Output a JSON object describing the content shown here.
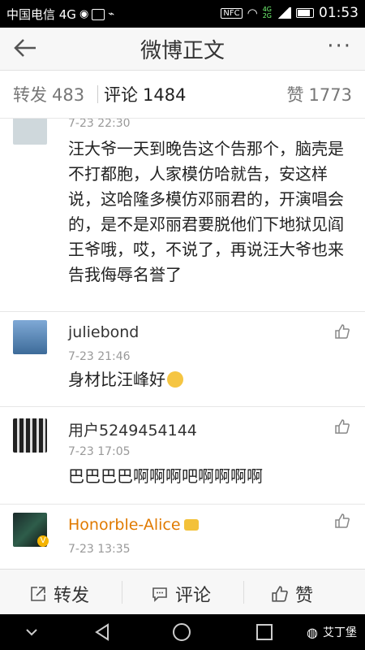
{
  "status_bar": {
    "carrier": "中国电信 4G",
    "nfc": "NFC",
    "net_top": "4G",
    "net_bottom": "2G",
    "time": "01:53"
  },
  "title_bar": {
    "back_icon": "back-arrow-icon",
    "title": "微博正文",
    "more_icon": "more-dots-icon",
    "more_glyph": "···"
  },
  "tabs": {
    "repost_label": "转发",
    "repost_count": "483",
    "comment_label": "评论",
    "comment_count": "1484",
    "like_label": "赞",
    "like_count": "1773"
  },
  "comments": [
    {
      "time": "7-23 22:30",
      "text": "汪大爷一天到晚告这个告那个，脑壳是不打都胞，人家模仿哈就告，安这样说，这哈隆多模仿邓丽君的，开演唱会的，是不是邓丽君要脱他们下地狱见阎王爷哦，哎，不说了，再说汪大爷也来告我侮辱名誉了"
    },
    {
      "username": "juliebond",
      "time": "7-23 21:46",
      "text": "身材比汪峰好"
    },
    {
      "username": "用户5249454144",
      "time": "7-23 17:05",
      "text": "巴巴巴巴啊啊啊吧啊啊啊啊"
    },
    {
      "username": "Honorble-Alice",
      "time": "7-23 13:35",
      "badge": "V"
    }
  ],
  "action_bar": {
    "repost_label": "转发",
    "comment_label": "评论",
    "like_label": "赞"
  },
  "nav_bar": {
    "watermark": "艾丁堡"
  },
  "colors": {
    "vip_name": "#e07a00",
    "status_bg": "#000000",
    "title_bg": "#f7f7f7"
  }
}
